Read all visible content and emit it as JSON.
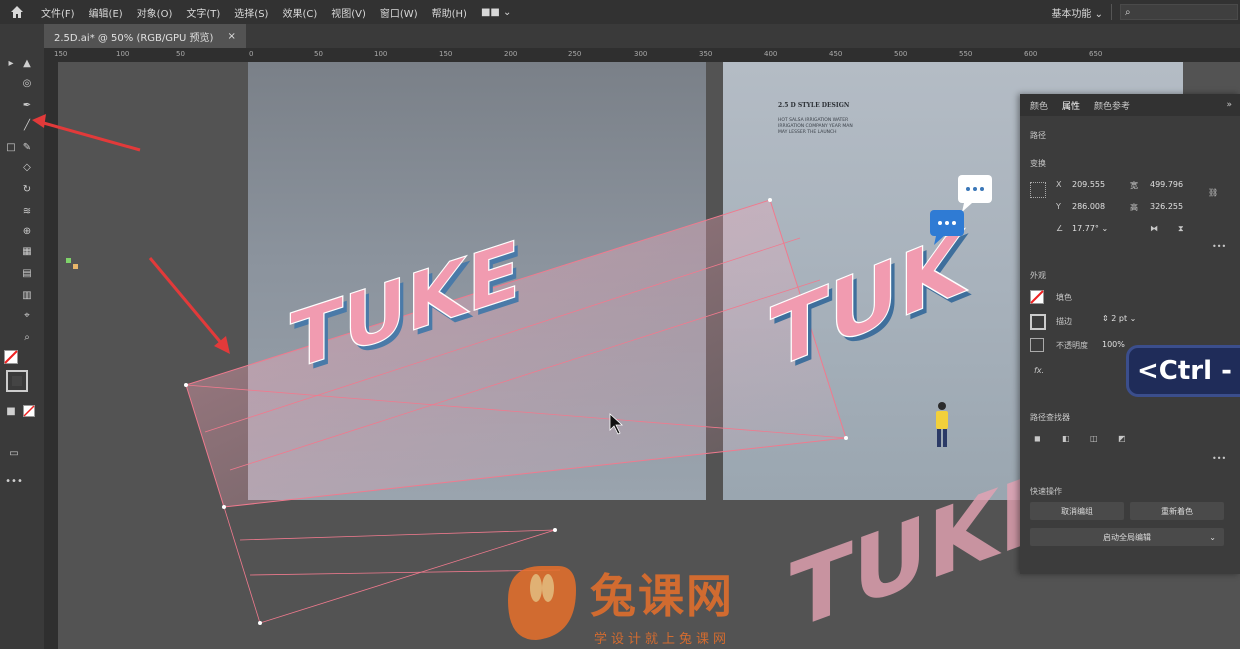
{
  "menubar": {
    "items": [
      "文件(F)",
      "编辑(E)",
      "对象(O)",
      "文字(T)",
      "选择(S)",
      "效果(C)",
      "视图(V)",
      "窗口(W)",
      "帮助(H)"
    ],
    "view_switcher": "■■",
    "workspace": "基本功能"
  },
  "document_tab": {
    "title": "2.5D.ai* @ 50% (RGB/GPU 预览)",
    "close": "×"
  },
  "ruler": {
    "ticks": [
      "150",
      "100",
      "50",
      "0",
      "50",
      "100",
      "150",
      "200",
      "250",
      "300",
      "350",
      "400",
      "450",
      "500",
      "550",
      "600",
      "650"
    ]
  },
  "artboard_right": {
    "heading": "2.5 D STYLE DESIGN",
    "body": "HOT SALSA IRRIGATION WATER\nIRRIGATION COMPANY YEAR MAN\nMAY LESSER THE LAUNCH"
  },
  "artwork": {
    "word_left": "TUKE",
    "word_right": "TUK",
    "word_ghost": "TUKE"
  },
  "properties_panel": {
    "tabs": [
      "颜色",
      "属性",
      "颜色参考"
    ],
    "collapse": "»",
    "section_path": "路径",
    "section_transform": "变换",
    "x_label": "X",
    "x_value": "209.555",
    "y_label": "Y",
    "y_value": "286.008",
    "w_label": "宽",
    "w_value": "499.796",
    "h_label": "高",
    "h_value": "326.255",
    "angle_value": "17.77°",
    "section_appearance": "外观",
    "fill_label": "填色",
    "stroke_label": "描边",
    "stroke_value": "2 pt",
    "opacity_label": "不透明度",
    "opacity_value": "100%",
    "fx_label": "fx.",
    "section_pathfinder": "路径查找器",
    "section_quick": "快速操作",
    "btn_ungroup": "取消编组",
    "btn_recolor": "重新着色",
    "btn_global": "启动全局编辑",
    "more": "•••"
  },
  "shortcut_overlay": "<Ctrl -",
  "watermark": {
    "brand": "兔课网",
    "slogan": "学设计就上兔课网"
  },
  "colors": {
    "menubar": "#323232",
    "panel": "#3c3c3c",
    "letter_face": "#f19bb0",
    "letter_side": "#4a7aa8",
    "arrow": "#e23a3a",
    "watermark": "#e8702a"
  }
}
